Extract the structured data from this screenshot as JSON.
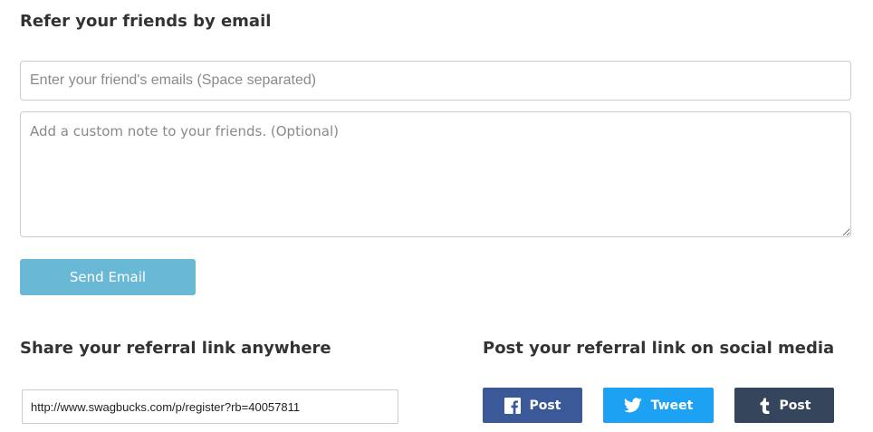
{
  "refer_email": {
    "title": "Refer your friends by email",
    "email_placeholder": "Enter your friend's emails (Space separated)",
    "email_value": "",
    "note_placeholder": "Add a custom note to your friends. (Optional)",
    "note_value": "",
    "send_label": "Send Email"
  },
  "share_link": {
    "title": "Share your referral link anywhere",
    "url": "http://www.swagbucks.com/p/register?rb=40057811"
  },
  "social": {
    "title": "Post your referral link on social media",
    "buttons": [
      {
        "network": "facebook",
        "icon": "facebook-icon",
        "label": "Post",
        "color": "#3b5998"
      },
      {
        "network": "twitter",
        "icon": "twitter-icon",
        "label": "Tweet",
        "color": "#1da1f2"
      },
      {
        "network": "tumblr",
        "icon": "tumblr-icon",
        "label": "Post",
        "color": "#35465c"
      }
    ]
  },
  "colors": {
    "send_button": "#69b8d6",
    "heading_text": "#333333",
    "input_border": "#cccccc"
  }
}
